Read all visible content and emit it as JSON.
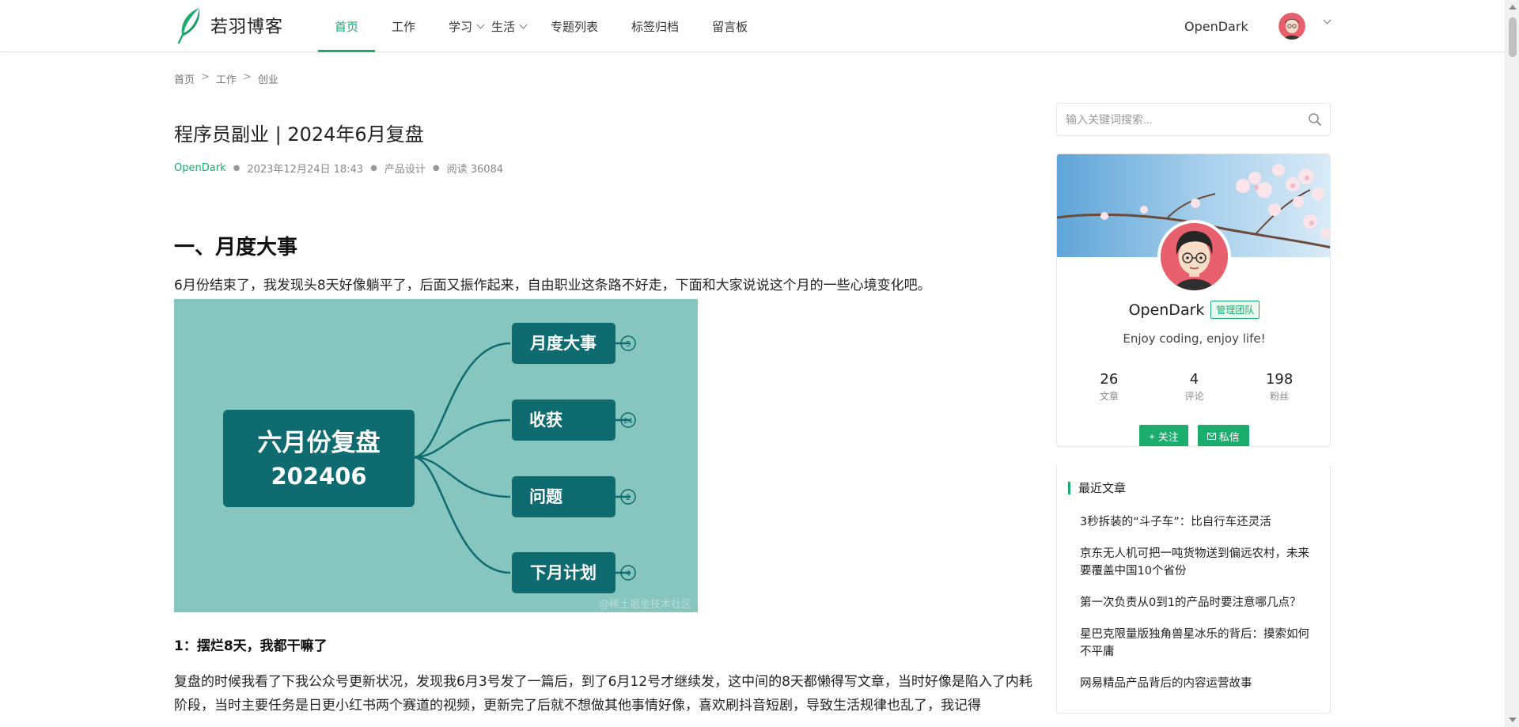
{
  "header": {
    "site_name": "若羽博客",
    "nav": [
      {
        "label": "首页",
        "active": true
      },
      {
        "label": "工作"
      },
      {
        "label": "学习",
        "dropdown": true
      },
      {
        "label": "生活",
        "dropdown": true
      },
      {
        "label": "专题列表"
      },
      {
        "label": "标签归档"
      },
      {
        "label": "留言板"
      }
    ],
    "user_name": "OpenDark"
  },
  "breadcrumb": [
    "首页",
    "工作",
    "创业"
  ],
  "article": {
    "title": "程序员副业 | 2024年6月复盘",
    "author": "OpenDark",
    "date": "2023年12月24日 18:43",
    "category": "产品设计",
    "views": "阅读 36084",
    "section1_heading": "一、月度大事",
    "section1_intro": "6月份结束了，我发现头8天好像躺平了，后面又振作起来，自由职业这条路不好走，下面和大家说说这个月的一些心境变化吧。",
    "mindmap": {
      "center_line1": "六月份复盘",
      "center_line2": "202406",
      "branches": [
        {
          "label": "月度大事",
          "count": "5"
        },
        {
          "label": "收获",
          "count": "24"
        },
        {
          "label": "问题",
          "count": "2"
        },
        {
          "label": "下月计划",
          "count": "4"
        }
      ],
      "watermark": "@稀土掘金技术社区"
    },
    "sub_heading": "1：摆烂8天，我都干嘛了",
    "paragraph": "复盘的时候我看了下我公众号更新状况，发现我6月3号发了一篇后，到了6月12号才继续发，这中间的8天都懒得写文章，当时好像是陷入了内耗阶段，当时主要任务是日更小红书两个赛道的视频，更新完了后就不想做其他事情好像，喜欢刷抖音短剧，导致生活规律也乱了，我记得"
  },
  "sidebar": {
    "search_placeholder": "输入关键词搜索...",
    "profile": {
      "name": "OpenDark",
      "badge": "管理团队",
      "motto": "Enjoy coding, enjoy life!",
      "stats": [
        {
          "num": "26",
          "label": "文章"
        },
        {
          "num": "4",
          "label": "评论"
        },
        {
          "num": "198",
          "label": "粉丝"
        }
      ],
      "follow_label": "关注",
      "message_label": "私信"
    },
    "recent_title": "最近文章",
    "recent_posts": [
      "3秒拆装的“斗子车”：比自行车还灵活",
      "京东无人机可把一吨货物送到偏远农村，未来要覆盖中国10个省份",
      "第一次负责从0到1的产品时要注意哪几点？",
      "星巴克限量版独角兽星冰乐的背后：摸索如何不平庸",
      "网易精品产品背后的内容运营故事"
    ]
  },
  "colors": {
    "accent": "#1aad6e",
    "mindmap_bg": "#86c6bf",
    "mindmap_node": "#0e6b70"
  }
}
